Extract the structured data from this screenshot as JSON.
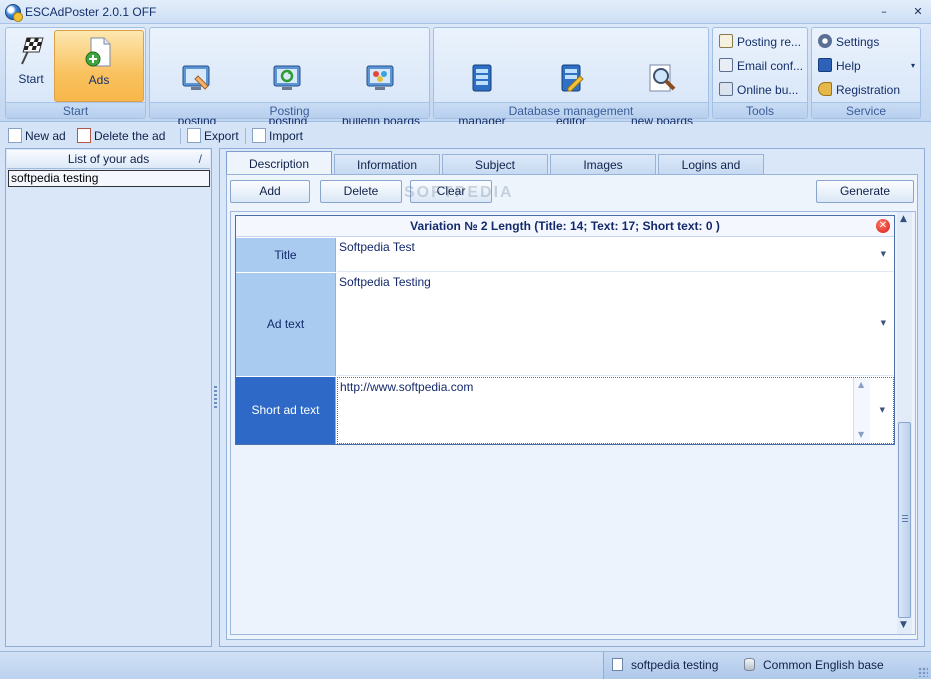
{
  "window": {
    "title": "ESCAdPoster 2.0.1 OFF",
    "minimize": "–",
    "close": "✕"
  },
  "ribbon": {
    "start_group": {
      "label": "Start",
      "buttons": [
        "Start",
        "Ads"
      ]
    },
    "posting_group": {
      "label": "Posting",
      "buttons": [
        "Manual\nposting",
        "Automatic\nposting",
        "Popular\nbulletin boards"
      ]
    },
    "db_group": {
      "label": "Database management",
      "buttons": [
        "Database\nmanager",
        "Database\neditor",
        "Search for\nnew boards"
      ]
    },
    "tools_group": {
      "label": "Tools",
      "buttons": [
        "Posting re...",
        "Email conf...",
        "Online bu..."
      ]
    },
    "service_group": {
      "label": "Service",
      "buttons": [
        "Settings",
        "Help",
        "Registration"
      ]
    },
    "active_button": "Ads"
  },
  "toolbar": {
    "new_ad": "New ad",
    "delete_ad": "Delete the ad",
    "export": "Export",
    "import": "Import"
  },
  "ads_list": {
    "header": "List of your ads",
    "sort_glyph": "/",
    "items": [
      "softpedia testing"
    ]
  },
  "tabs": [
    "Description",
    "Information",
    "Subject",
    "Images",
    "Logins and passwo..."
  ],
  "actions": {
    "add": "Add",
    "delete": "Delete",
    "clear": "Clear",
    "generate": "Generate"
  },
  "variation": {
    "header": "Variation № 2 Length (Title: 14;  Text: 17;  Short text: 0 )",
    "rows": [
      {
        "label": "Title",
        "value": "Softpedia Test"
      },
      {
        "label": "Ad text",
        "value": "Softpedia Testing"
      },
      {
        "label": "Short ad text",
        "value": "http://www.softpedia.com"
      }
    ]
  },
  "watermark": "SOFTPEDIA",
  "status": {
    "ad_name": "softpedia testing",
    "database": "Common English base"
  },
  "colors": {
    "accent": "#2f69c7",
    "active_button": "#f9c25f",
    "close_red": "#d71d14"
  }
}
